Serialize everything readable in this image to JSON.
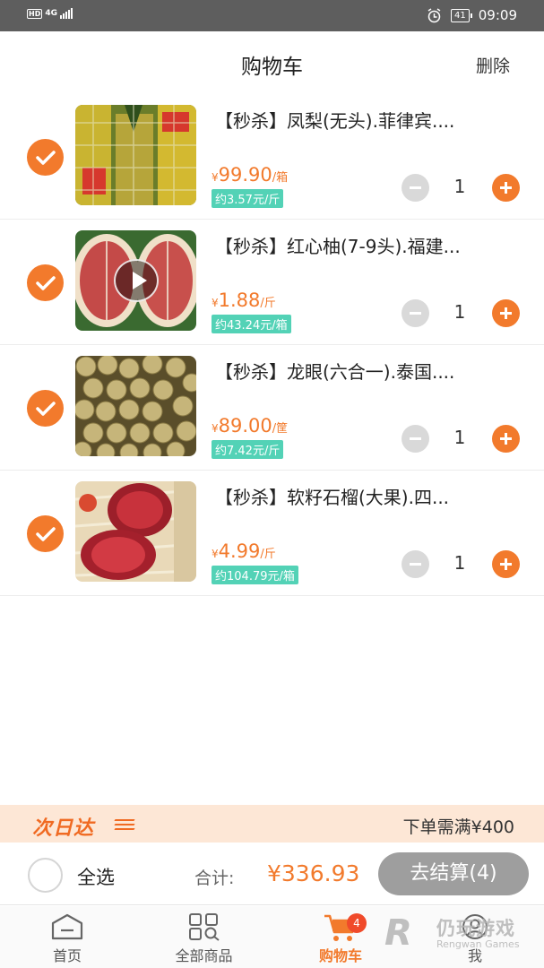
{
  "status_bar": {
    "network_left": "HD",
    "network_type": "4G",
    "battery": "41",
    "time": "09:09"
  },
  "header": {
    "title": "购物车",
    "delete_label": "删除"
  },
  "items": [
    {
      "name": "【秒杀】凤梨(无头).菲律宾....",
      "currency": "¥",
      "price": "99.90",
      "unit": "/箱",
      "unit_price": "约3.57元/斤",
      "qty": "1",
      "checked": true,
      "has_video": false
    },
    {
      "name": "【秒杀】红心柚(7-9头).福建...",
      "currency": "¥",
      "price": "1.88",
      "unit": "/斤",
      "unit_price": "约43.24元/箱",
      "qty": "1",
      "checked": true,
      "has_video": true
    },
    {
      "name": "【秒杀】龙眼(六合一).泰国....",
      "currency": "¥",
      "price": "89.00",
      "unit": "/筐",
      "unit_price": "约7.42元/斤",
      "qty": "1",
      "checked": true,
      "has_video": false
    },
    {
      "name": "【秒杀】软籽石榴(大果).四...",
      "currency": "¥",
      "price": "4.99",
      "unit": "/斤",
      "unit_price": "约104.79元/箱",
      "qty": "1",
      "checked": true,
      "has_video": false
    }
  ],
  "banner": {
    "logo_text": "次日达",
    "min_order": "下单需满¥400"
  },
  "checkout": {
    "select_all": "全选",
    "total_label": "合计:",
    "total_value": "¥336.93",
    "settle_button": "去结算(4)"
  },
  "tabs": [
    {
      "label": "首页",
      "icon": "home-icon"
    },
    {
      "label": "全部商品",
      "icon": "grid-icon"
    },
    {
      "label": "购物车",
      "icon": "cart-icon",
      "badge": "4",
      "active": true
    },
    {
      "label": "我",
      "icon": "user-icon"
    }
  ],
  "watermark": {
    "cn": "仍玩游戏",
    "en": "Rengwan Games"
  },
  "colors": {
    "accent": "#f27a2c",
    "unit_price_bg": "#53d2b6",
    "banner_bg": "#fde7d6",
    "settle_bg": "#9e9e9e"
  }
}
